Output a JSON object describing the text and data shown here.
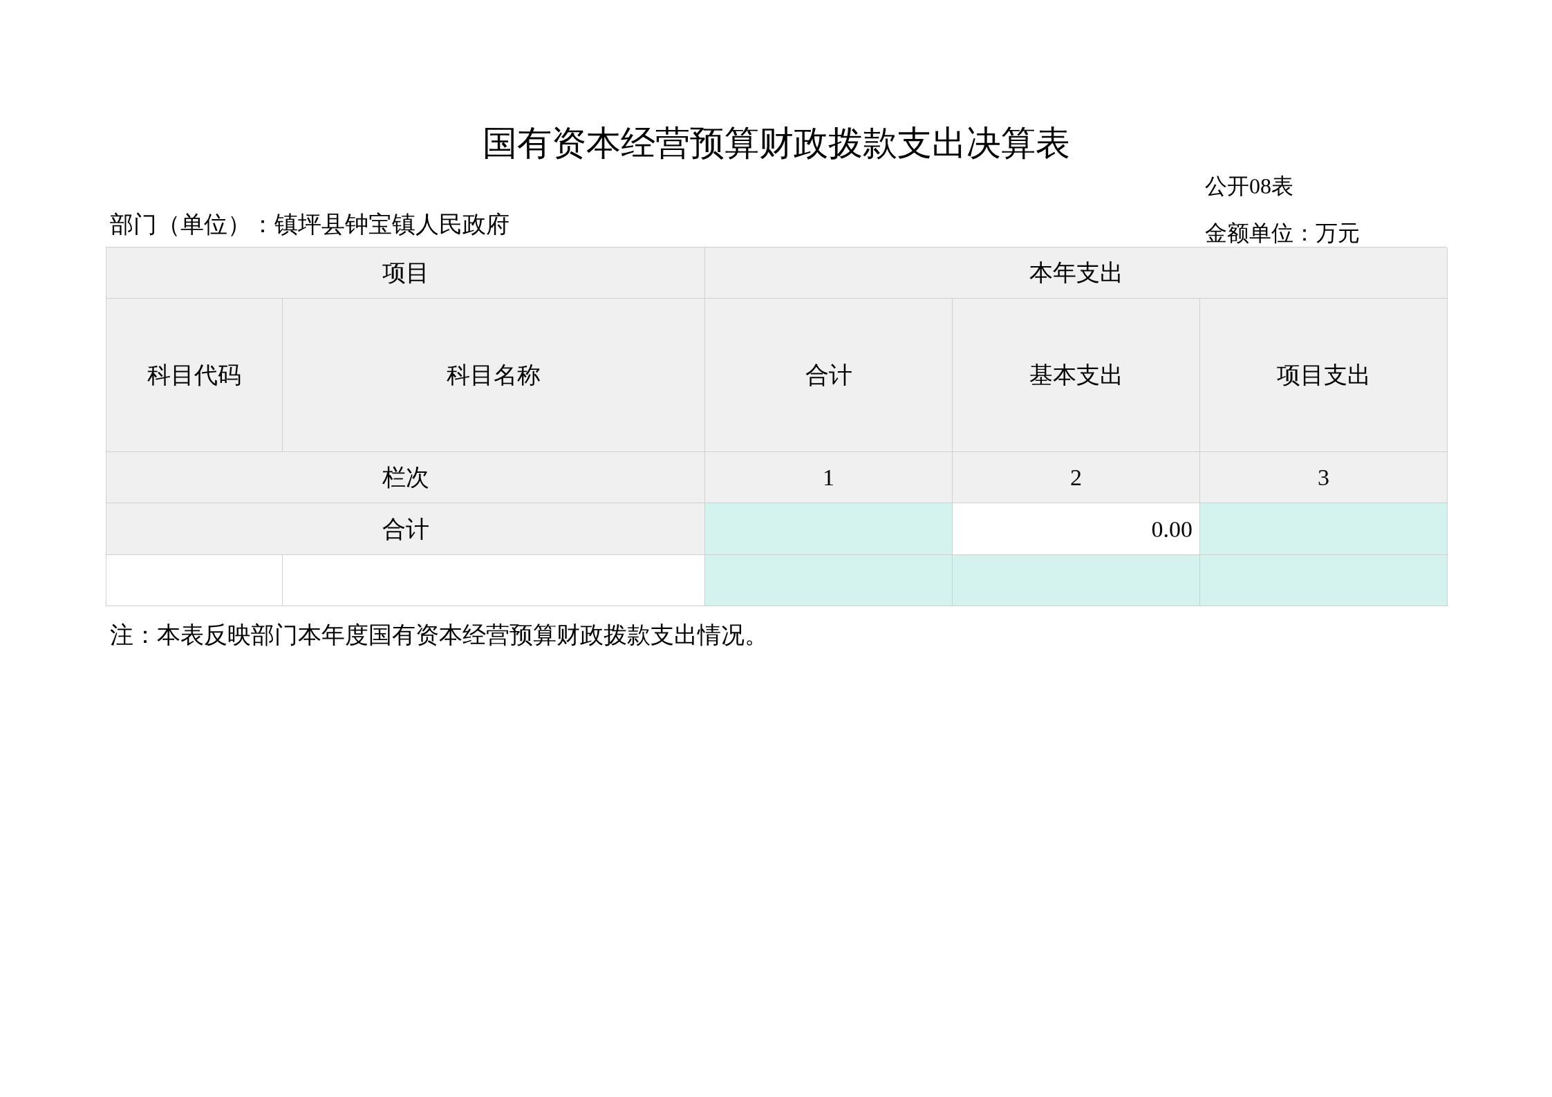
{
  "title": "国有资本经营预算财政拨款支出决算表",
  "table_no": "公开08表",
  "department": "部门（单位）：镇坪县钟宝镇人民政府",
  "unit": "金额单位：万元",
  "table": {
    "group_headers": [
      "项目",
      "本年支出"
    ],
    "column_headers": [
      "科目代码",
      "科目名称",
      "合计",
      "基本支出",
      "项目支出"
    ],
    "index_row": [
      "栏次",
      "1",
      "2",
      "3"
    ],
    "rows": [
      {
        "kind": "total",
        "label": "合计",
        "cells": [
          {
            "shaded": true
          },
          {
            "value": "0.00",
            "shaded": false
          },
          {
            "shaded": true
          }
        ]
      },
      {
        "kind": "item",
        "cells": [
          {
            "shaded": true
          },
          {
            "shaded": true
          },
          {
            "shaded": true
          }
        ]
      }
    ]
  },
  "note": "注：本表反映部门本年度国有资本经营预算财政拨款支出情况。"
}
